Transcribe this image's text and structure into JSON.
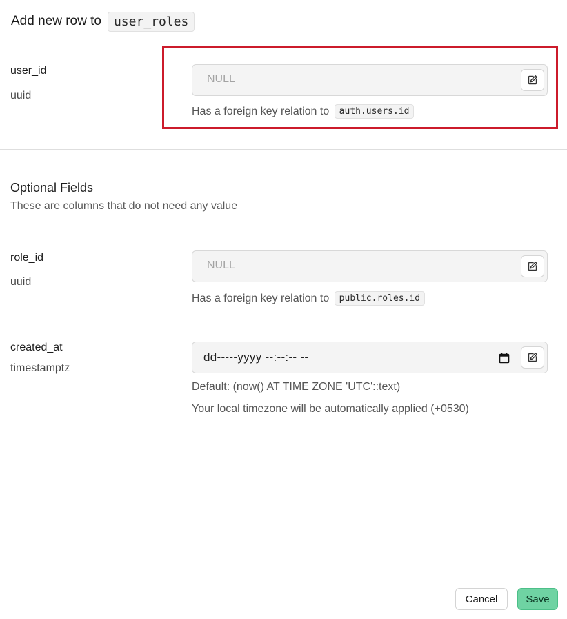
{
  "header": {
    "title": "Add new row to",
    "table_name": "user_roles"
  },
  "required_fields": [
    {
      "name": "user_id",
      "type": "uuid",
      "value_placeholder": "NULL",
      "hint": "Has a foreign key relation to",
      "relation": "auth.users.id"
    }
  ],
  "optional_section": {
    "title": "Optional Fields",
    "subtitle": "These are columns that do not need any value"
  },
  "optional_fields": [
    {
      "name": "role_id",
      "type": "uuid",
      "value_placeholder": "NULL",
      "hint": "Has a foreign key relation to",
      "relation": "public.roles.id"
    },
    {
      "name": "created_at",
      "type": "timestamptz",
      "value": "dd-----yyyy --:--:-- --",
      "default_hint": "Default: (now() AT TIME ZONE 'UTC'::text)",
      "timezone_hint": "Your local timezone will be automatically applied (+0530)"
    }
  ],
  "footer": {
    "cancel_label": "Cancel",
    "save_label": "Save"
  },
  "colors": {
    "highlight": "#cc1b2b",
    "save_bg": "#6fd3a3"
  },
  "icons": {
    "edit": "edit-icon",
    "calendar": "calendar-icon"
  }
}
